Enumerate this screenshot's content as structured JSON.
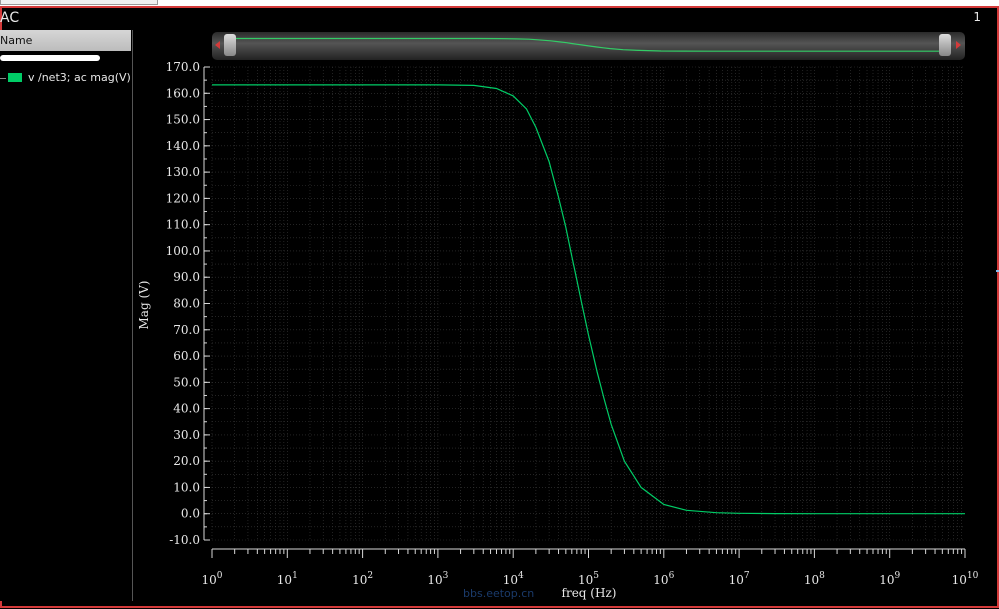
{
  "window": {
    "title": "AC",
    "subwindow_number": "1"
  },
  "legend": {
    "header": "Name",
    "entries": [
      {
        "label": "v /net3; ac mag(V)",
        "color": "#00cc66"
      }
    ]
  },
  "watermark": "bbs.eetop.cn",
  "chart_data": {
    "type": "line",
    "xlabel": "freq (Hz)",
    "ylabel": "Mag (V)",
    "x_scale": "log",
    "xlim": [
      1,
      10000000000
    ],
    "ylim": [
      -10,
      170
    ],
    "x_ticks": [
      {
        "base": "10",
        "exp": "0"
      },
      {
        "base": "10",
        "exp": "1"
      },
      {
        "base": "10",
        "exp": "2"
      },
      {
        "base": "10",
        "exp": "3"
      },
      {
        "base": "10",
        "exp": "4"
      },
      {
        "base": "10",
        "exp": "5"
      },
      {
        "base": "10",
        "exp": "6"
      },
      {
        "base": "10",
        "exp": "7"
      },
      {
        "base": "10",
        "exp": "8"
      },
      {
        "base": "10",
        "exp": "9"
      },
      {
        "base": "10",
        "exp": "10"
      }
    ],
    "y_ticks": [
      "170.0",
      "160.0",
      "150.0",
      "140.0",
      "130.0",
      "120.0",
      "110.0",
      "100.0",
      "90.0",
      "80.0",
      "70.0",
      "60.0",
      "50.0",
      "40.0",
      "30.0",
      "20.0",
      "10.0",
      "0.0",
      "-10.0"
    ],
    "grid": true,
    "series": [
      {
        "name": "v /net3; ac mag(V)",
        "color": "#00cc66",
        "x": [
          1,
          10,
          100,
          1000,
          3000,
          6000,
          10000,
          15000,
          20000,
          30000,
          40000,
          50000,
          60000,
          70000,
          80000,
          100000,
          130000,
          160000,
          200000,
          300000,
          500000,
          1000000,
          2000000,
          5000000,
          10000000,
          30000000,
          100000000,
          1000000000,
          10000000000
        ],
        "y": [
          163.2,
          163.2,
          163.2,
          163.2,
          163.0,
          161.8,
          159.0,
          154.0,
          147.0,
          134.0,
          120.5,
          109.0,
          98.0,
          89.0,
          81.0,
          68.0,
          54.0,
          44.0,
          34.0,
          20.0,
          10.0,
          3.5,
          1.3,
          0.4,
          0.15,
          0.04,
          0.0,
          0.0,
          0.0
        ]
      }
    ]
  }
}
